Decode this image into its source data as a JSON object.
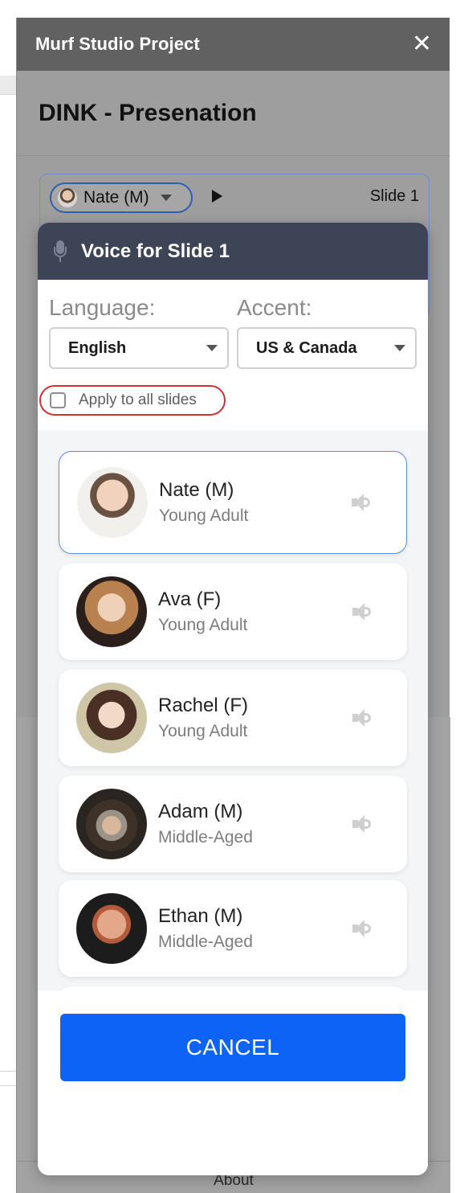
{
  "panel": {
    "title": "Murf Studio Project",
    "close_icon": "close-icon",
    "project_name": "DINK - Presenation",
    "about_label": "About"
  },
  "slide": {
    "voice_chip_label": "Nate (M)",
    "slide_label": "Slide 1"
  },
  "modal": {
    "title": "Voice for Slide 1",
    "language_label": "Language:",
    "language_value": "English",
    "accent_label": "Accent:",
    "accent_value": "US & Canada",
    "apply_all_label": "Apply to all slides",
    "apply_all_checked": false,
    "cancel_label": "CANCEL",
    "accent_color": "#0d63f6",
    "header_color": "#3c4456"
  },
  "voices": [
    {
      "name": "Nate (M)",
      "age": "Young Adult",
      "selected": true
    },
    {
      "name": "Ava (F)",
      "age": "Young Adult",
      "selected": false
    },
    {
      "name": "Rachel (F)",
      "age": "Young Adult",
      "selected": false
    },
    {
      "name": "Adam (M)",
      "age": "Middle-Aged",
      "selected": false
    },
    {
      "name": "Ethan (M)",
      "age": "Middle-Aged",
      "selected": false
    }
  ]
}
